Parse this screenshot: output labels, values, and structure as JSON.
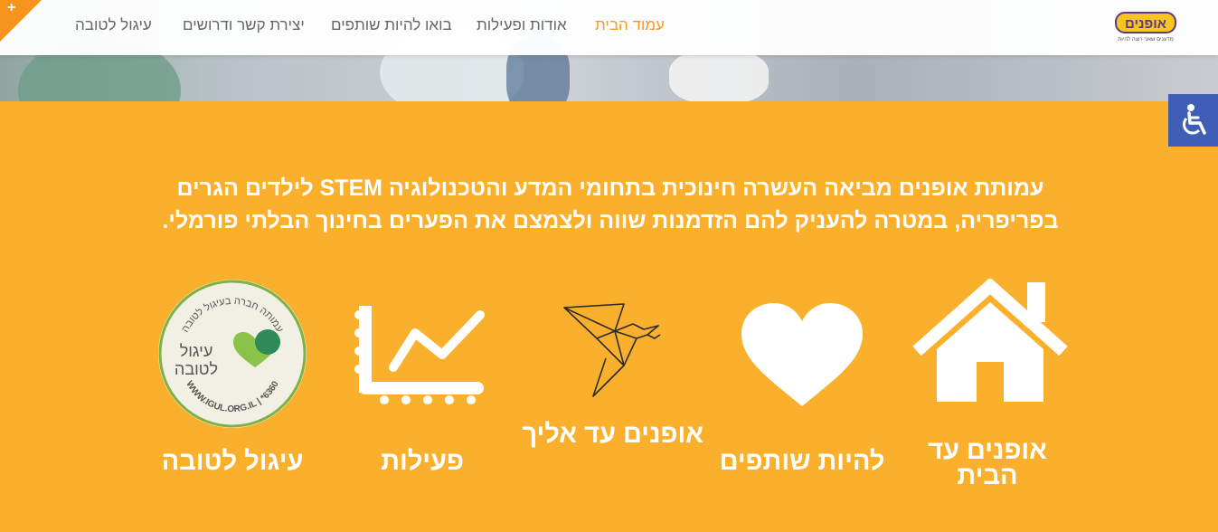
{
  "nav": {
    "items": [
      "עמוד הבית",
      "אודות ופעילות",
      "בואו להיות שותפים",
      "יצירת קשר ודרושים",
      "עיגול לטובה"
    ],
    "active_index": 0
  },
  "logo": {
    "text": "אופנים",
    "tagline": "מדענים שאני רוצה להיות"
  },
  "corner_icon": "+",
  "intro": "עמותת אופנים מביאה העשרה חינוכית בתחומי המדע והטכנולוגיה STEM לילדים הגרים בפריפריה, במטרה להעניק להם הזדמנות שווה ולצמצם את הפערים בחינוך הבלתי פורמלי.",
  "features": [
    {
      "label": "אופנים עד הבית",
      "icon": "house-icon"
    },
    {
      "label": "להיות שותפים",
      "icon": "heart-icon"
    },
    {
      "label": "אופנים עד אליך",
      "icon": "origami-bird-icon"
    },
    {
      "label": "פעילות",
      "icon": "chart-icon"
    },
    {
      "label": "עיגול לטובה",
      "icon": "igul-seal-icon"
    }
  ],
  "seal": {
    "top_text": "עמותה חברה בעיגול לטובה",
    "center_line1": "עיגול",
    "center_line2": "לטובה",
    "bottom_text": "WWW.IGUL.ORG.IL | *6360"
  },
  "colors": {
    "brand_orange": "#fbb02d",
    "accent": "#f59a1c",
    "accessibility_blue": "#3f5fb7",
    "seal_green": "#7cb342"
  }
}
